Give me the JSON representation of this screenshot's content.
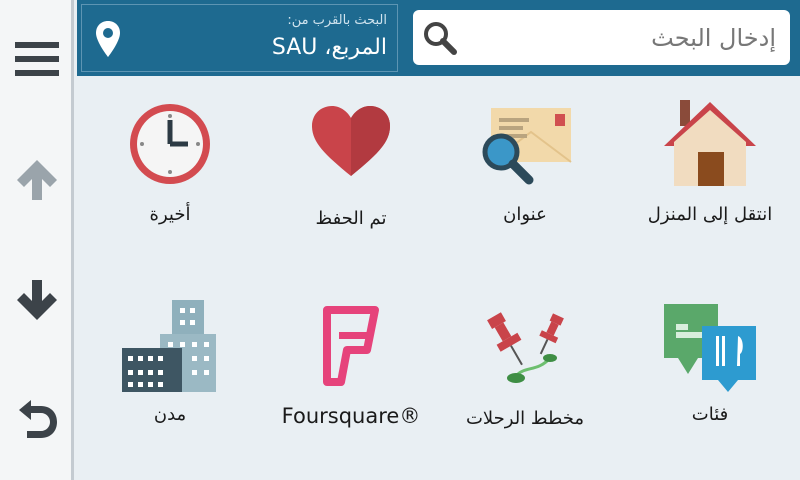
{
  "search": {
    "placeholder": "إدخال البحث"
  },
  "near": {
    "label": "البحث بالقرب من:",
    "value": "المربع، SAU"
  },
  "categories": {
    "go_home": "انتقل إلى المنزل",
    "address": "عنوان",
    "saved": "تم الحفظ",
    "recent": "أخيرة",
    "categories": "فئات",
    "trip_planner": "مخطط الرحلات",
    "foursquare": "Foursquare®",
    "cities": "مدن"
  },
  "sidebar": {
    "menu_icon": "hamburger-menu-icon",
    "up_icon": "arrow-up-icon",
    "down_icon": "arrow-down-icon",
    "back_icon": "back-icon"
  },
  "colors": {
    "topbar": "#1e6a90",
    "accent_red": "#c9444a",
    "foursquare_pink": "#e6437b"
  }
}
